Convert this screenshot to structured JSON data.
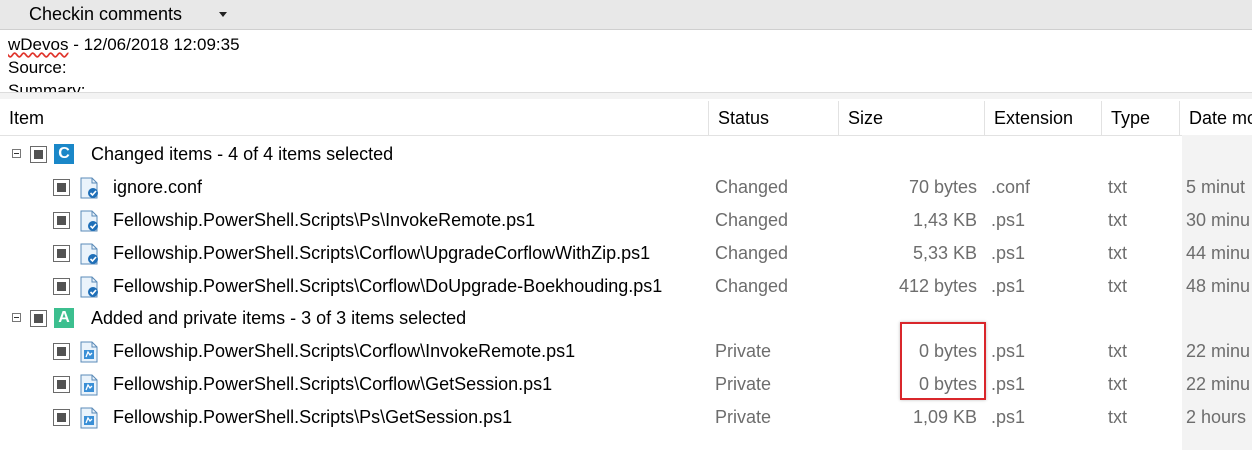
{
  "panel": {
    "title": "Checkin comments"
  },
  "comments": {
    "line1_user": "wDevos",
    "line1_rest": " - 12/06/2018 12:09:35",
    "line2": "Source:",
    "line3": "Summary:"
  },
  "columns": [
    "Item",
    "Status",
    "Size",
    "Extension",
    "Type",
    "Date mo"
  ],
  "groups": [
    {
      "badge": "C",
      "badge_color": "#1a87c8",
      "label": "Changed items - 4 of 4 items selected",
      "items": [
        {
          "name": "ignore.conf",
          "status": "Changed",
          "size": "70 bytes",
          "extension": ".conf",
          "type": "txt",
          "date": "5 minut"
        },
        {
          "name": "Fellowship.PowerShell.Scripts\\Ps\\InvokeRemote.ps1",
          "status": "Changed",
          "size": "1,43 KB",
          "extension": ".ps1",
          "type": "txt",
          "date": "30 minu"
        },
        {
          "name": "Fellowship.PowerShell.Scripts\\Corflow\\UpgradeCorflowWithZip.ps1",
          "status": "Changed",
          "size": "5,33 KB",
          "extension": ".ps1",
          "type": "txt",
          "date": "44 minu"
        },
        {
          "name": "Fellowship.PowerShell.Scripts\\Corflow\\DoUpgrade-Boekhouding.ps1",
          "status": "Changed",
          "size": "412 bytes",
          "extension": ".ps1",
          "type": "txt",
          "date": "48 minu"
        }
      ]
    },
    {
      "badge": "A",
      "badge_color": "#3cbf8f",
      "label": "Added and private items - 3 of 3 items selected",
      "items": [
        {
          "name": "Fellowship.PowerShell.Scripts\\Corflow\\InvokeRemote.ps1",
          "status": "Private",
          "size": "0 bytes",
          "extension": ".ps1",
          "type": "txt",
          "date": "22 minu"
        },
        {
          "name": "Fellowship.PowerShell.Scripts\\Corflow\\GetSession.ps1",
          "status": "Private",
          "size": "0 bytes",
          "extension": ".ps1",
          "type": "txt",
          "date": "22 minu"
        },
        {
          "name": "Fellowship.PowerShell.Scripts\\Ps\\GetSession.ps1",
          "status": "Private",
          "size": "1,09 KB",
          "extension": ".ps1",
          "type": "txt",
          "date": "2 hours"
        }
      ]
    }
  ],
  "icons": {
    "changed_file": "changed-file-icon",
    "added_file": "private-file-icon"
  }
}
